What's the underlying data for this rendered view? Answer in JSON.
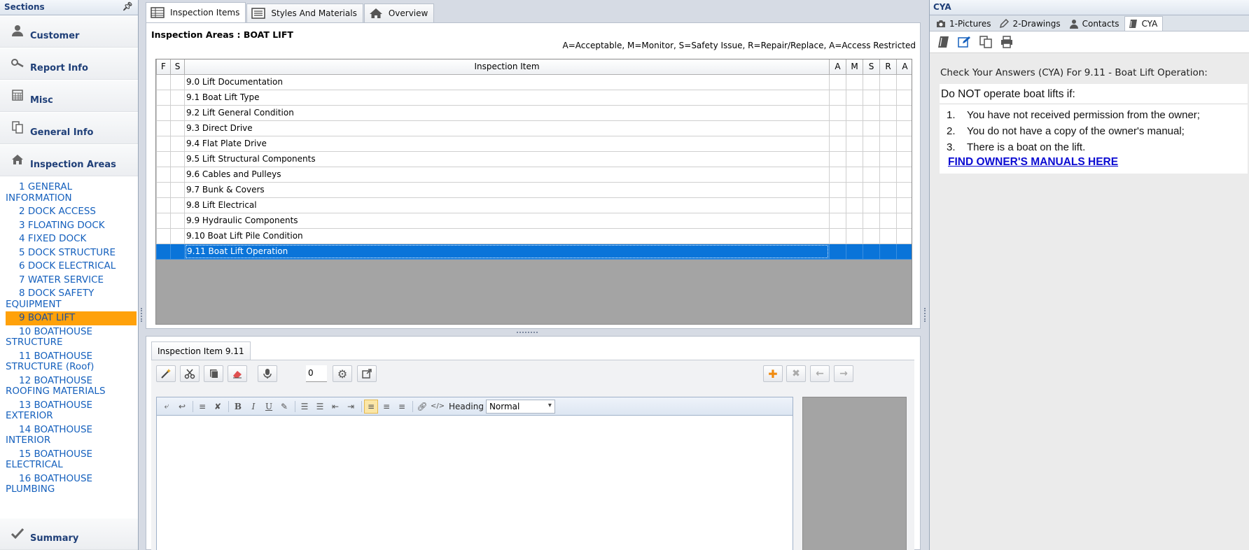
{
  "sidebar": {
    "title": "Sections",
    "pin_icon": "pin-icon",
    "sections": [
      {
        "label": "Customer",
        "icon": "person-icon"
      },
      {
        "label": "Report Info",
        "icon": "magnifier-icon"
      },
      {
        "label": "Misc",
        "icon": "calculator-icon"
      },
      {
        "label": "General Info",
        "icon": "documents-icon"
      },
      {
        "label": "Inspection Areas",
        "icon": "house-icon"
      }
    ],
    "areas": [
      "1 GENERAL INFORMATION",
      "2 DOCK ACCESS",
      "3 FLOATING DOCK",
      "4 FIXED DOCK",
      "5 DOCK STRUCTURE",
      "6 DOCK ELECTRICAL",
      "7 WATER SERVICE",
      "8 DOCK SAFETY EQUIPMENT",
      "9 BOAT LIFT",
      "10 BOATHOUSE STRUCTURE",
      "11 BOATHOUSE STRUCTURE (Roof)",
      "12 BOATHOUSE ROOFING MATERIALS",
      "13 BOATHOUSE EXTERIOR",
      "14 BOATHOUSE INTERIOR",
      "15 BOATHOUSE ELECTRICAL",
      "16 BOATHOUSE PLUMBING"
    ],
    "active_area": "9 BOAT LIFT",
    "summary": {
      "label": "Summary",
      "icon": "checkmark-icon"
    }
  },
  "top_tabs": [
    {
      "label": "Inspection Items",
      "icon": "grid-icon"
    },
    {
      "label": "Styles And Materials",
      "icon": "list-icon"
    },
    {
      "label": "Overview",
      "icon": "house-icon"
    }
  ],
  "inspection": {
    "area_title": "Inspection Areas : BOAT LIFT",
    "legend": "A=Acceptable, M=Monitor, S=Safety Issue, R=Repair/Replace, A=Access Restricted",
    "columns": {
      "f": "F",
      "s": "S",
      "item": "Inspection Item",
      "a": "A",
      "m": "M",
      "s2": "S",
      "r": "R",
      "a2": "A"
    },
    "rows": [
      "9.0 Lift Documentation",
      "9.1 Boat Lift Type",
      "9.2 Lift General Condition",
      "9.3 Direct Drive",
      "9.4 Flat Plate Drive",
      "9.5 Lift Structural Components",
      "9.6 Cables and Pulleys",
      "9.7 Bunk & Covers",
      "9.8 Lift Electrical",
      "9.9 Hydraulic Components",
      "9.10 Boat Lift Pile Condition",
      "9.11 Boat Lift Operation"
    ],
    "selected_row": "9.11 Boat Lift Operation"
  },
  "detail": {
    "tab_label": "Inspection Item 9.11",
    "counter_value": "0",
    "heading_label": "Heading",
    "heading_value": "Normal"
  },
  "right": {
    "title": "CYA",
    "tabs": [
      {
        "label": "1-Pictures",
        "icon": "camera-icon"
      },
      {
        "label": "2-Drawings",
        "icon": "pencil-icon"
      },
      {
        "label": "Contacts",
        "icon": "person-icon"
      },
      {
        "label": "CYA",
        "icon": "book-icon"
      }
    ],
    "cya_heading": "Check Your Answers (CYA) For 9.11 - Boat Lift Operation:",
    "intro": "Do NOT operate boat lifts if:",
    "items": [
      {
        "num": "1.",
        "text": "You have not received permission from the owner;"
      },
      {
        "num": "2.",
        "text": "You do not have a copy of the owner's manual;"
      },
      {
        "num": "3.",
        "text": "There is a boat on the lift."
      }
    ],
    "link_text": "FIND OWNER'S MANUALS HERE"
  },
  "colors": {
    "accent_blue": "#1560bd",
    "active_area_bg": "#ffa10a",
    "selected_row_bg": "#0a74d9",
    "link": "#0a0ad2"
  }
}
